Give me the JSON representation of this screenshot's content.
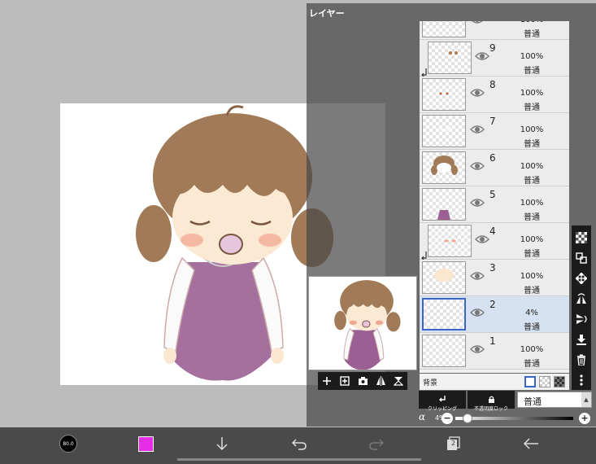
{
  "panel": {
    "title": "レイヤー"
  },
  "layers": [
    {
      "num": "",
      "opacity": "100%",
      "blend": "普通",
      "visible": true,
      "clipping": false,
      "selected": false,
      "thumb": "partial"
    },
    {
      "num": "9",
      "opacity": "100%",
      "blend": "普通",
      "visible": true,
      "clipping": true,
      "selected": false,
      "thumb": "eyes"
    },
    {
      "num": "8",
      "opacity": "100%",
      "blend": "普通",
      "visible": true,
      "clipping": false,
      "selected": false,
      "thumb": "dots"
    },
    {
      "num": "7",
      "opacity": "100%",
      "blend": "普通",
      "visible": true,
      "clipping": false,
      "selected": false,
      "thumb": "white"
    },
    {
      "num": "6",
      "opacity": "100%",
      "blend": "普通",
      "visible": true,
      "clipping": false,
      "selected": false,
      "thumb": "hair"
    },
    {
      "num": "5",
      "opacity": "100%",
      "blend": "普通",
      "visible": true,
      "clipping": false,
      "selected": false,
      "thumb": "dress"
    },
    {
      "num": "4",
      "opacity": "100%",
      "blend": "普通",
      "visible": true,
      "clipping": true,
      "selected": false,
      "thumb": "blush"
    },
    {
      "num": "3",
      "opacity": "100%",
      "blend": "普通",
      "visible": true,
      "clipping": false,
      "selected": false,
      "thumb": "skin"
    },
    {
      "num": "2",
      "opacity": "4%",
      "blend": "普通",
      "visible": true,
      "clipping": false,
      "selected": true,
      "thumb": "empty"
    },
    {
      "num": "1",
      "opacity": "100%",
      "blend": "普通",
      "visible": true,
      "clipping": false,
      "selected": false,
      "thumb": "empty"
    }
  ],
  "background": {
    "label": "背景",
    "swatches": [
      "white",
      "light-checker",
      "dark-checker"
    ]
  },
  "controls": {
    "clipping_label": "クリッピング",
    "alpha_lock_label": "不透明度ロック",
    "blend_mode": "普通",
    "alpha_symbol": "α",
    "alpha_value": "4%",
    "alpha_level": 0.04,
    "minus": "−",
    "plus": "+"
  },
  "preview_tools": [
    "add-layer-icon",
    "add-copy-icon",
    "camera-icon",
    "flip-icon",
    "transform-icon"
  ],
  "side_tools": [
    "checker-icon",
    "select-layer-icon",
    "move-icon",
    "flip-horizontal-icon",
    "flip-vertical-icon",
    "merge-down-icon",
    "trash-icon",
    "more-icon"
  ],
  "bottom_bar": {
    "brush_size": "80.0",
    "color": "#e62de6",
    "page_count": "2",
    "icons": [
      "brush-size-icon",
      "color-swatch",
      "down-arrow-icon",
      "undo-icon",
      "redo-icon",
      "layers-icon",
      "back-icon"
    ]
  },
  "colors": {
    "selection": "#3a66c6",
    "selected_row": "#d6e1f1",
    "hair": "#a17a57",
    "dress": "#9b5f93"
  }
}
